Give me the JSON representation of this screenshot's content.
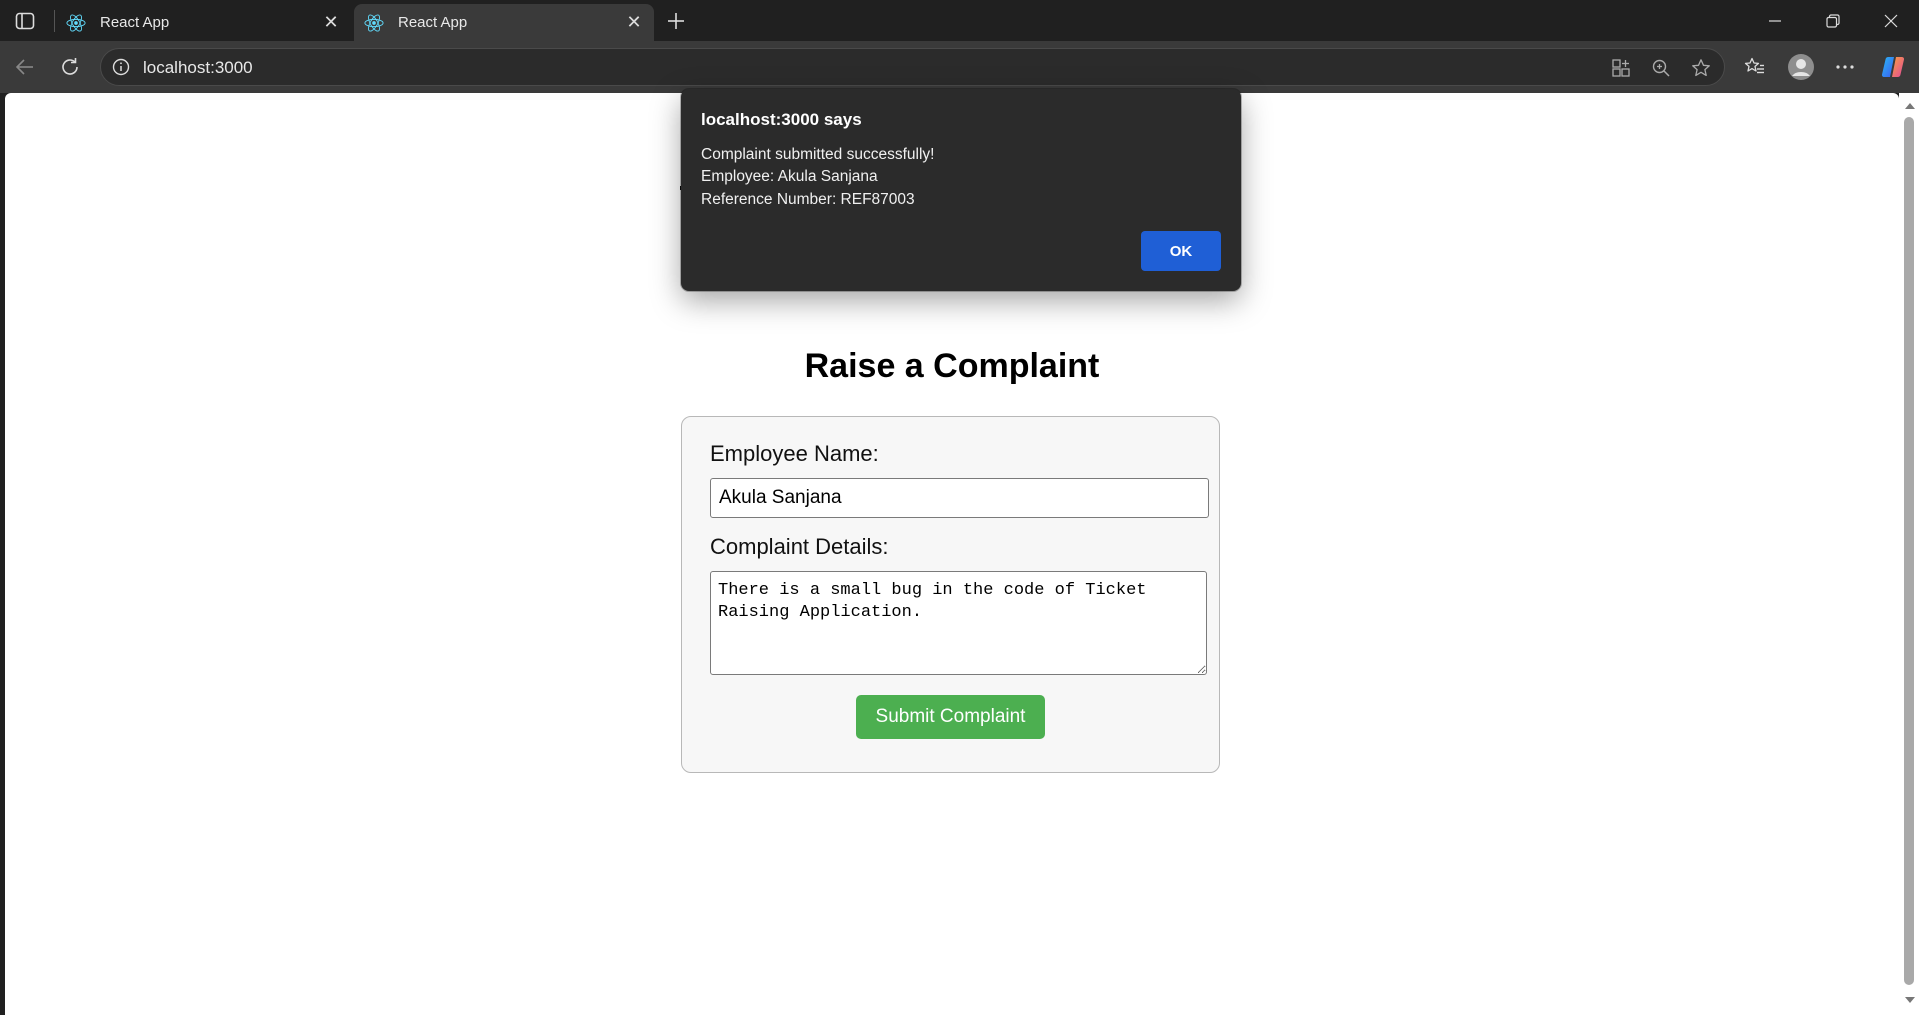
{
  "browser": {
    "tabs": [
      {
        "label": "React App"
      },
      {
        "label": "React App"
      }
    ],
    "url": "localhost:3000",
    "icons": {
      "tab_actions": "sidebar-toggle-icon",
      "favicon": "react-logo-icon",
      "close": "close-icon",
      "new_tab": "plus-icon",
      "back": "back-arrow-icon",
      "reload": "reload-icon",
      "site_info": "info-icon",
      "apps": "apps-icon",
      "zoom": "zoom-icon",
      "favorite": "star-icon",
      "favorites": "favorites-icon",
      "profile": "profile-icon",
      "more": "more-icon",
      "copilot": "copilot-icon"
    }
  },
  "page": {
    "heading": "Raise a Complaint",
    "form": {
      "employee_label": "Employee Name:",
      "employee_value": "Akula Sanjana",
      "details_label": "Complaint Details:",
      "details_value": "There is a small bug in the code of Ticket Raising Application.",
      "submit_label": "Submit Complaint"
    }
  },
  "alert": {
    "title": "localhost:3000 says",
    "message_line1": "Complaint submitted successfully!",
    "message_line2": "Employee: Akula Sanjana",
    "message_line3": "Reference Number: REF87003",
    "ok_label": "OK"
  },
  "colors": {
    "submit_button": "#4caf50",
    "ok_button": "#1f5fd6",
    "dialog_bg": "#2b2b2b",
    "chrome_bg": "#202020"
  }
}
